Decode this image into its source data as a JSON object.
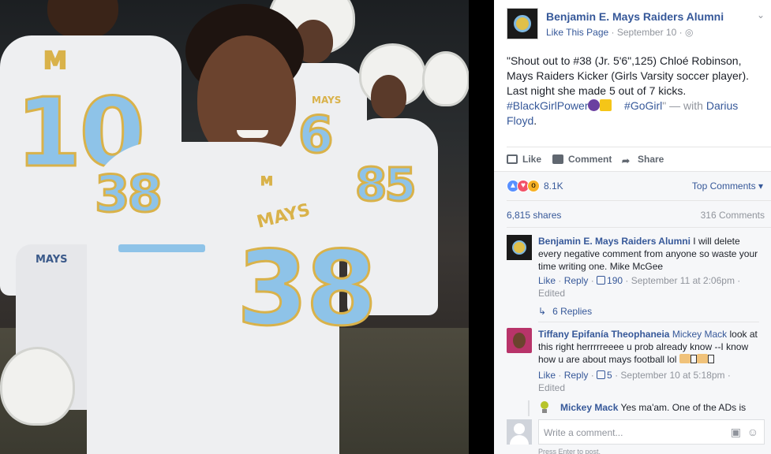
{
  "photo": {
    "jersey_numbers": [
      "10",
      "38",
      "6",
      "85",
      "38"
    ],
    "jersey_texts": [
      "MAYS",
      "MAYS",
      "MAYS",
      "M",
      "M"
    ]
  },
  "post": {
    "page_name": "Benjamin E. Mays Raiders Alumni",
    "like_page": "Like This Page",
    "date": "September 10",
    "text_main": "\"Shout out to #38 (Jr. 5'6\",125) Chloé Robinson, Mays Raiders Kicker (Girls Varsity soccer player). Last night she made 5 out of 7 kicks. ",
    "hashtag1": "#BlackGirlPower",
    "hashtag2": "#GoGirl",
    "with_text": "\" — with",
    "tagged": "Darius Floyd"
  },
  "actions": {
    "like": "Like",
    "comment": "Comment",
    "share": "Share"
  },
  "stats": {
    "reaction_count": "8.1K",
    "top_comments": "Top Comments",
    "shares": "6,815 shares",
    "comments": "316 Comments"
  },
  "comments": [
    {
      "author": "Benjamin E. Mays Raiders Alumni",
      "text": "I will delete every negative comment from anyone so waste your time writing one. Mike McGee",
      "like": "Like",
      "reply": "Reply",
      "likes": "190",
      "time": "September 11 at 2:06pm",
      "edited": "Edited",
      "replies": "6 Replies"
    },
    {
      "author": "Tiffany Epifanía Theophaneia",
      "mention": "Mickey Mack",
      "text": "look at this right herrrrreeee u prob already know --I know how u are about mays football lol",
      "like": "Like",
      "reply": "Reply",
      "likes": "5",
      "time": "September 10 at 5:18pm",
      "edited": "Edited"
    },
    {
      "author": "Mickey Mack",
      "text": "Yes ma'am. One of the ADs is"
    }
  ],
  "composer": {
    "placeholder": "Write a comment...",
    "hint": "Press Enter to post."
  },
  "colors": {
    "link": "#365899",
    "muted": "#90949c",
    "jersey_blue": "#8ec3e8",
    "jersey_gold": "#d9b24a"
  }
}
